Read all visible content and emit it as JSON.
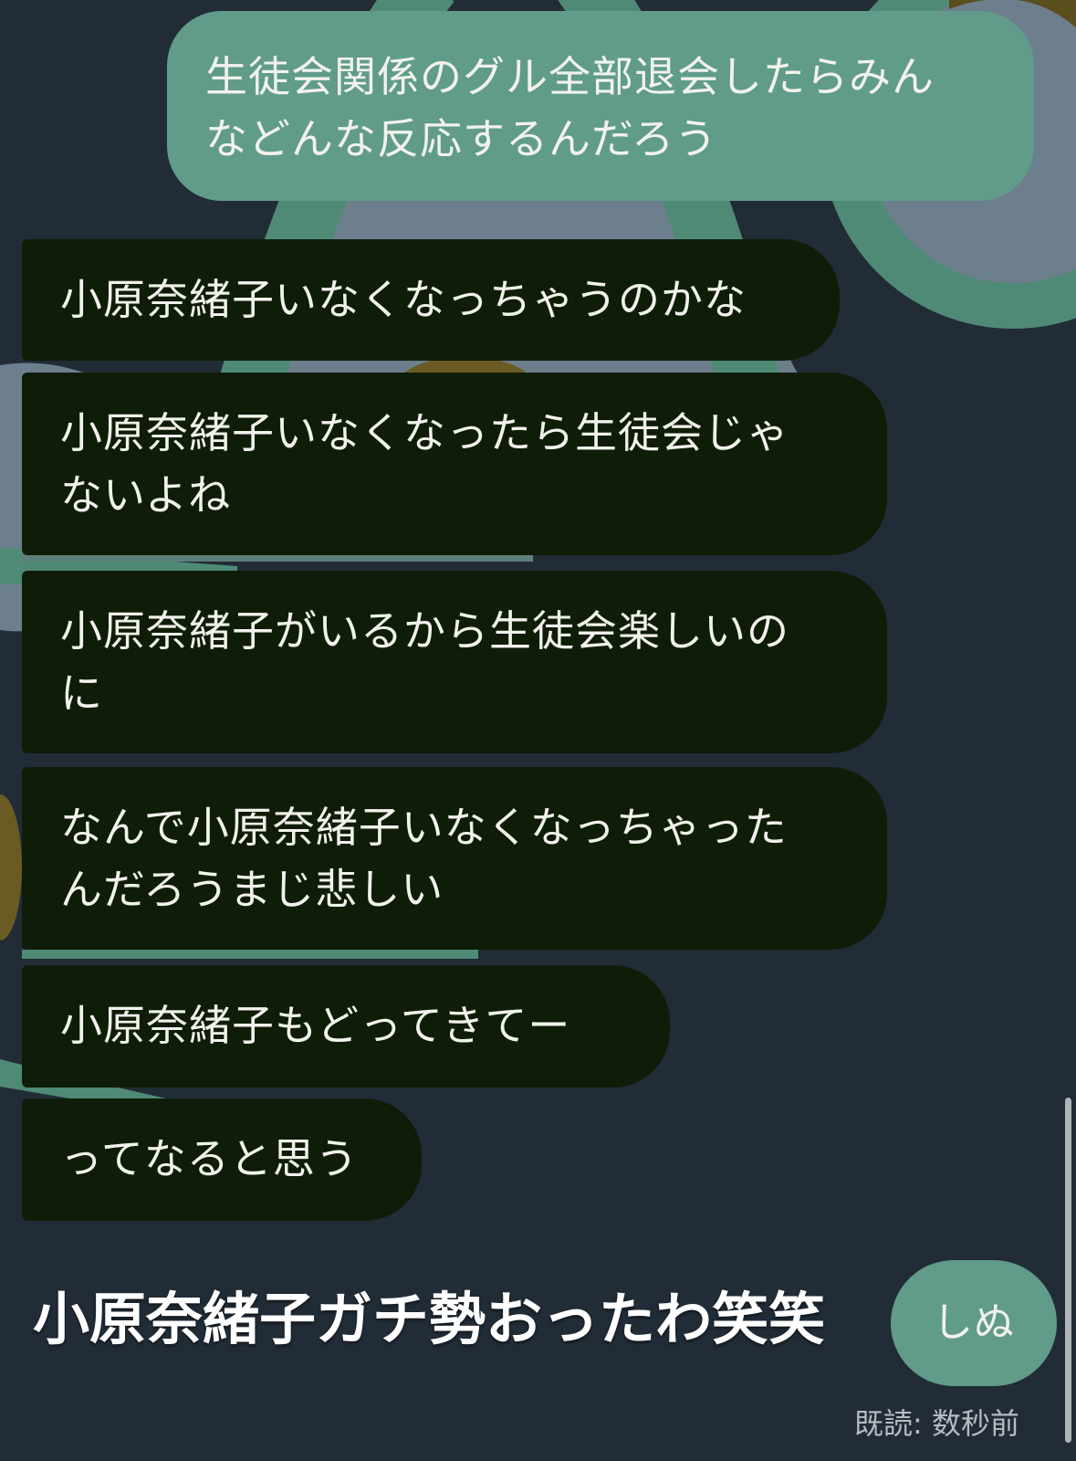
{
  "theme": {
    "background": "#212c37",
    "sent_bubble": "#609c89",
    "received_bubble": "#0f1d08",
    "message_text": "#f2f2ec",
    "caption_text": "#ffffff",
    "read_receipt_text": "#b6bcc2"
  },
  "chat": {
    "messages": [
      {
        "side": "sent",
        "lines": [
          "生徒会関係のグル全部退会したらみん",
          "などんな反応するんだろう"
        ]
      },
      {
        "side": "received",
        "lines": [
          "小原奈緒子いなくなっちゃうのかな"
        ]
      },
      {
        "side": "received",
        "lines": [
          "小原奈緒子いなくなったら生徒会じゃ",
          "ないよね"
        ]
      },
      {
        "side": "received",
        "lines": [
          "小原奈緒子がいるから生徒会楽しいの",
          "に"
        ]
      },
      {
        "side": "received",
        "lines": [
          "なんで小原奈緒子いなくなっちゃった",
          "んだろうまじ悲しい"
        ]
      },
      {
        "side": "received",
        "lines": [
          "小原奈緒子もどってきてー"
        ]
      },
      {
        "side": "received",
        "lines": [
          "ってなると思う"
        ]
      },
      {
        "side": "sent",
        "lines": [
          "しぬ"
        ]
      }
    ],
    "overlay_caption": "小原奈緒子ガチ勢おったわ笑笑",
    "read_receipt": "既読: 数秒前"
  }
}
